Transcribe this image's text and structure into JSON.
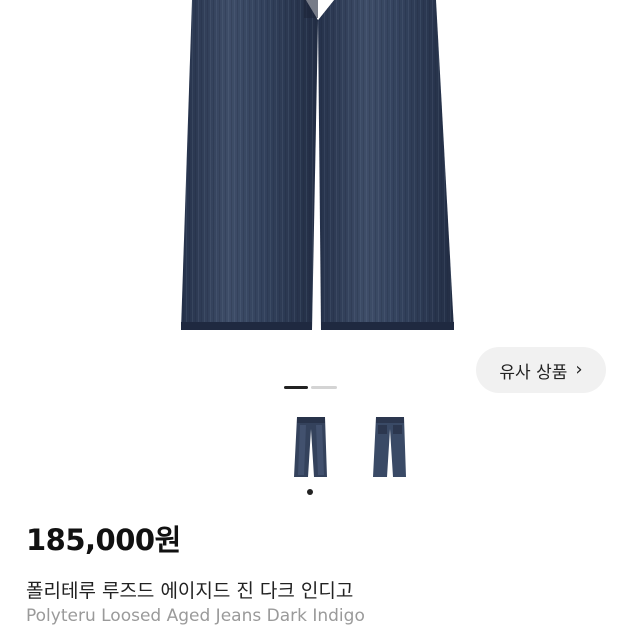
{
  "similar_button": {
    "label": "유사 상품",
    "chevron": "›",
    "icon": "chevron-right-icon"
  },
  "product": {
    "price": "185,000원",
    "title_ko": "폴리테루 루즈드 에이지드 진 다크 인디고",
    "title_en": "Polyteru Loosed Aged Jeans Dark Indigo"
  },
  "gallery": {
    "active_index": 0,
    "image_count": 2,
    "colors": {
      "denim": "#2c3a52",
      "denim_light": "#4a5a74"
    }
  }
}
